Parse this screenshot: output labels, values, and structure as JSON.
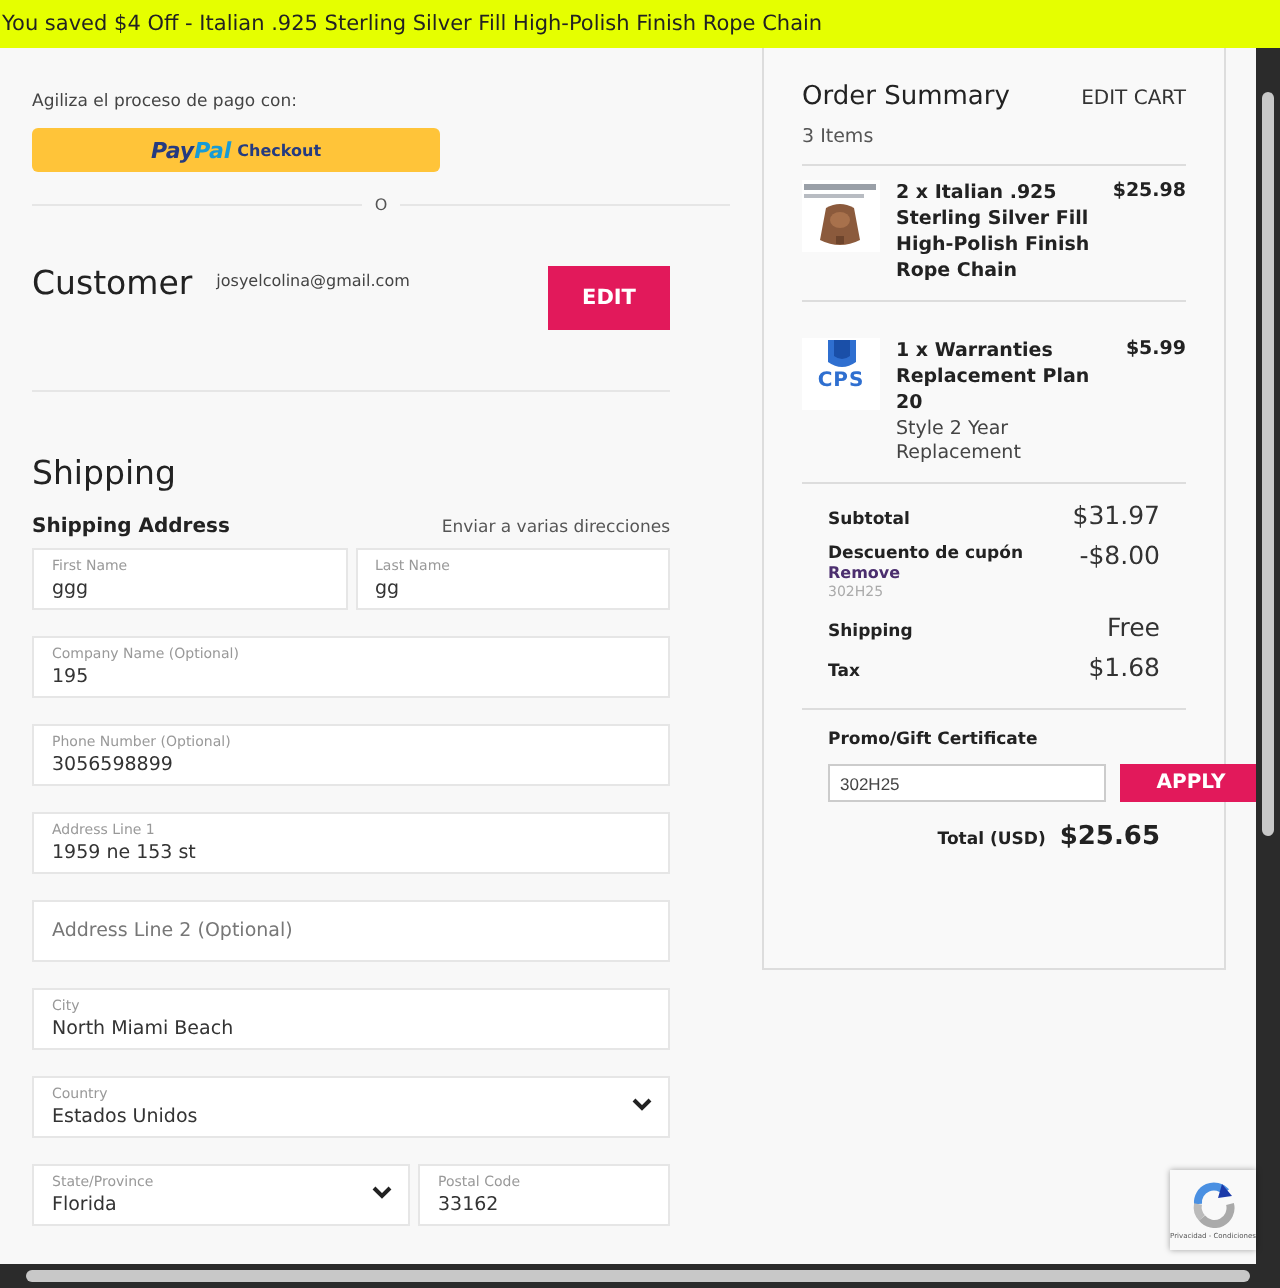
{
  "banner": {
    "text": "You saved $4 Off - Italian .925 Sterling Silver Fill High-Polish Finish Rope Chain"
  },
  "express": {
    "label": "Agiliza el proceso de pago con:",
    "paypal_brand_1": "Pay",
    "paypal_brand_2": "Pal",
    "paypal_action": "Checkout",
    "divider_text": "O"
  },
  "customer": {
    "title": "Customer",
    "email": "josyelcolina@gmail.com",
    "edit_button": "EDIT"
  },
  "shipping": {
    "title": "Shipping",
    "subtitle": "Shipping Address",
    "multi_address_link": "Enviar a varias direcciones",
    "rows": [
      [
        {
          "kind": "text",
          "label": "First Name",
          "value": "ggg"
        },
        {
          "kind": "text",
          "label": "Last Name",
          "value": "gg"
        }
      ],
      [
        {
          "kind": "text",
          "label": "Company Name (Optional)",
          "value": "195"
        }
      ],
      [
        {
          "kind": "text",
          "label": "Phone Number (Optional)",
          "value": "3056598899"
        }
      ],
      [
        {
          "kind": "text",
          "label": "Address Line 1",
          "value": "1959 ne 153 st"
        }
      ],
      [
        {
          "kind": "empty",
          "placeholder": "Address Line 2 (Optional)"
        }
      ],
      [
        {
          "kind": "text",
          "label": "City",
          "value": "North Miami Beach"
        }
      ],
      [
        {
          "kind": "select",
          "label": "Country",
          "value": "Estados Unidos"
        }
      ],
      [
        {
          "kind": "select",
          "label": "State/Province",
          "value": "Florida"
        },
        {
          "kind": "text",
          "label": "Postal Code",
          "value": "33162"
        }
      ]
    ]
  },
  "summary": {
    "title": "Order Summary",
    "edit_cart": "EDIT CART",
    "count": "3 Items",
    "items": [
      {
        "kind": "picture",
        "name": "2 x Italian .925 Sterling Silver Fill High-Polish Finish Rope Chain",
        "price": "$25.98"
      },
      {
        "kind": "logo",
        "logo_text": "CPS",
        "name": "1 x Warranties Replacement Plan 20",
        "detail": "Style 2 Year Replacement",
        "price": "$5.99"
      }
    ],
    "totals": [
      {
        "kind": "plain",
        "label": "Subtotal",
        "value": "$31.97"
      },
      {
        "kind": "coupon",
        "label": "Descuento de cupón",
        "remove": "Remove",
        "code": "302H25",
        "value": "-$8.00"
      },
      {
        "kind": "plain",
        "label": "Shipping",
        "value": "Free"
      },
      {
        "kind": "plain",
        "label": "Tax",
        "value": "$1.68"
      }
    ],
    "promo": {
      "label": "Promo/Gift Certificate",
      "value": "302H25",
      "button": "APPLY"
    },
    "total": {
      "label": "Total (USD)",
      "value": "$25.65"
    }
  },
  "recaptcha": {
    "links": "Privacidad - Condiciones"
  }
}
